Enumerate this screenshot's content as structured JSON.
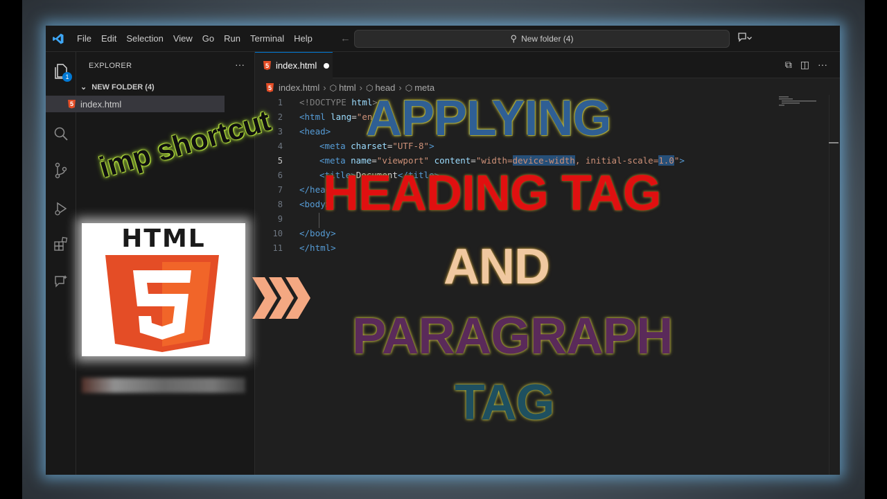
{
  "menu": [
    "File",
    "Edit",
    "Selection",
    "View",
    "Go",
    "Run",
    "Terminal",
    "Help"
  ],
  "command_center": {
    "text": "New folder (4)"
  },
  "activity": {
    "explorer_badge": "1"
  },
  "sidebar": {
    "title": "EXPLORER",
    "more": "···",
    "folder": "NEW FOLDER (4)",
    "file": "index.html"
  },
  "tab": {
    "label": "index.html"
  },
  "breadcrumb": [
    "index.html",
    "html",
    "head",
    "meta"
  ],
  "line_numbers": [
    "1",
    "2",
    "3",
    "4",
    "5",
    "6",
    "7",
    "8",
    "9",
    "10",
    "11"
  ],
  "active_line": "5",
  "code": {
    "l1_a": "<!DOCTYPE ",
    "l1_b": "html",
    "l1_c": ">",
    "l2_a": "<html ",
    "l2_b": "lang",
    "l2_c": "=",
    "l2_d": "\"en\"",
    "l3": "<head>",
    "l4_a": "<meta ",
    "l4_b": "charset",
    "l4_c": "=",
    "l4_d": "\"UTF-8\"",
    "l4_e": ">",
    "l5_a": "<meta ",
    "l5_b": "name",
    "l5_c": "=",
    "l5_d": "\"viewport\"",
    "l5_e": " content",
    "l5_f": "=",
    "l5_g": "\"width=",
    "l5_h": "device-width",
    "l5_i": ", initial-scale=",
    "l5_j": "1.0",
    "l5_k": "\"",
    "l5_l": ">",
    "l6_a": "<title>",
    "l6_b": "Document",
    "l6_c": "</title>",
    "l7": "</head>",
    "l8": "<body>",
    "l10": "</body>",
    "l11": "</html>"
  },
  "overlay": {
    "applying": "APPLYING",
    "heading_tag": "HEADING TAG",
    "and": "AND",
    "paragraph": "PARAGRAPH",
    "tag": "TAG",
    "imp_shortcut": "imp shortcut",
    "html_logo_word": "HTML",
    "html_logo_digit": "5"
  },
  "colors": {
    "accent": "#0078d4",
    "html5_orange": "#e44d26",
    "html5_orange_light": "#f16529",
    "arrow_color": "#f4a882"
  },
  "icons": [
    "vscode-logo-icon",
    "search-icon",
    "arrow-left-icon",
    "arrow-right-icon",
    "copilot-icon",
    "files-icon",
    "search-icon",
    "source-control-icon",
    "run-debug-icon",
    "extensions-icon",
    "chat-icon",
    "split-editor-icon",
    "more-icon"
  ]
}
